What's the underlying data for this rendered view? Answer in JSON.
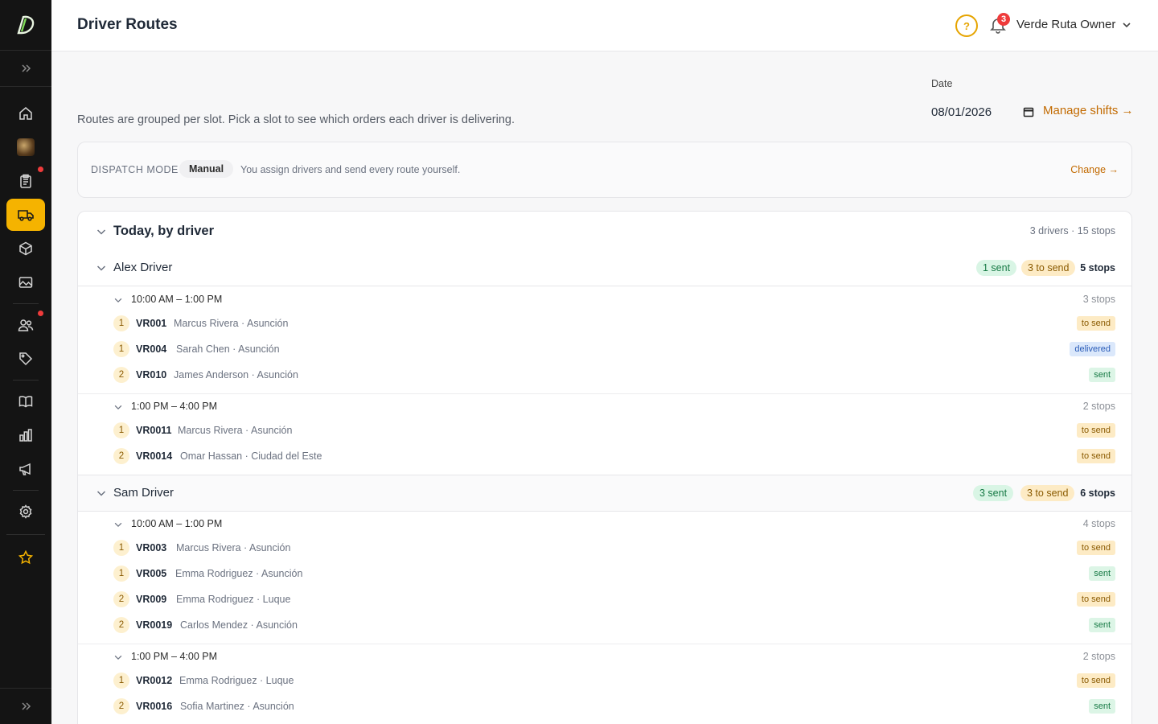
{
  "header": {
    "title": "Driver Routes",
    "help_icon": "help-circle-icon",
    "notifications_count": "3",
    "user_name": "Verde Ruta Owner"
  },
  "sidebar": {
    "items": [
      {
        "name": "home",
        "icon": "home-icon"
      },
      {
        "name": "store",
        "icon": "store-avatar"
      },
      {
        "name": "orders",
        "icon": "clipboard-icon",
        "dot": true
      },
      {
        "name": "routes",
        "icon": "truck-icon",
        "active": true
      },
      {
        "name": "products",
        "icon": "box-icon"
      },
      {
        "name": "media",
        "icon": "image-icon"
      },
      {
        "name": "customers",
        "icon": "users-icon",
        "dot": true
      },
      {
        "name": "promotions",
        "icon": "tag-icon"
      },
      {
        "name": "catalog",
        "icon": "book-icon"
      },
      {
        "name": "analytics",
        "icon": "bar-chart-icon"
      },
      {
        "name": "marketing",
        "icon": "megaphone-icon"
      },
      {
        "name": "settings",
        "icon": "gear-icon"
      },
      {
        "name": "favorites",
        "icon": "star-icon"
      }
    ]
  },
  "page": {
    "subtitle": "Routes are grouped per slot. Pick a slot to see which orders each driver is delivering.",
    "date_label": "Date",
    "date_value": "08/01/2026",
    "manage_shifts": "Manage shifts →"
  },
  "dispatch": {
    "label": "DISPATCH MODE",
    "mode": "Manual",
    "description": "You assign drivers and send every route yourself.",
    "change": "Change →"
  },
  "routes": {
    "title": "Today, by driver",
    "summary": "3 drivers · 15 stops",
    "drivers": [
      {
        "name": "Alex Driver",
        "sent": "1 sent",
        "to_send": "3 to send",
        "stops": "5 stops",
        "slots": [
          {
            "time": "10:00 AM – 1:00 PM",
            "stops": "3 stops",
            "orders": [
              {
                "seq": "1",
                "id": "VR001",
                "info": "Marcus Rivera · Asunción",
                "status": "to send"
              },
              {
                "seq": "1",
                "id": "VR004",
                "info": "Sarah Chen · Asunción",
                "status": "delivered"
              },
              {
                "seq": "2",
                "id": "VR010",
                "info": "James Anderson · Asunción",
                "status": "sent"
              }
            ]
          },
          {
            "time": "1:00 PM – 4:00 PM",
            "stops": "2 stops",
            "orders": [
              {
                "seq": "1",
                "id": "VR0011",
                "info": "Marcus Rivera · Asunción",
                "status": "to send"
              },
              {
                "seq": "2",
                "id": "VR0014",
                "info": "Omar Hassan · Ciudad del Este",
                "status": "to send"
              }
            ]
          }
        ]
      },
      {
        "name": "Sam Driver",
        "sent": "3 sent",
        "to_send": "3 to send",
        "stops": "6 stops",
        "slots": [
          {
            "time": "10:00 AM – 1:00 PM",
            "stops": "4 stops",
            "orders": [
              {
                "seq": "1",
                "id": "VR003",
                "info": "Marcus Rivera · Asunción",
                "status": "to send"
              },
              {
                "seq": "1",
                "id": "VR005",
                "info": "Emma Rodriguez · Asunción",
                "status": "sent"
              },
              {
                "seq": "2",
                "id": "VR009",
                "info": "Emma Rodriguez · Luque",
                "status": "to send"
              },
              {
                "seq": "2",
                "id": "VR0019",
                "info": "Carlos Mendez · Asunción",
                "status": "sent"
              }
            ]
          },
          {
            "time": "1:00 PM – 4:00 PM",
            "stops": "2 stops",
            "orders": [
              {
                "seq": "1",
                "id": "VR0012",
                "info": "Emma Rodriguez · Luque",
                "status": "to send"
              },
              {
                "seq": "2",
                "id": "VR0016",
                "info": "Sofia Martinez · Asunción",
                "status": "sent"
              }
            ]
          }
        ]
      }
    ]
  },
  "colors": {
    "accent": "#f5b300",
    "link": "#c26a00",
    "sidebar_bg": "#141414"
  }
}
